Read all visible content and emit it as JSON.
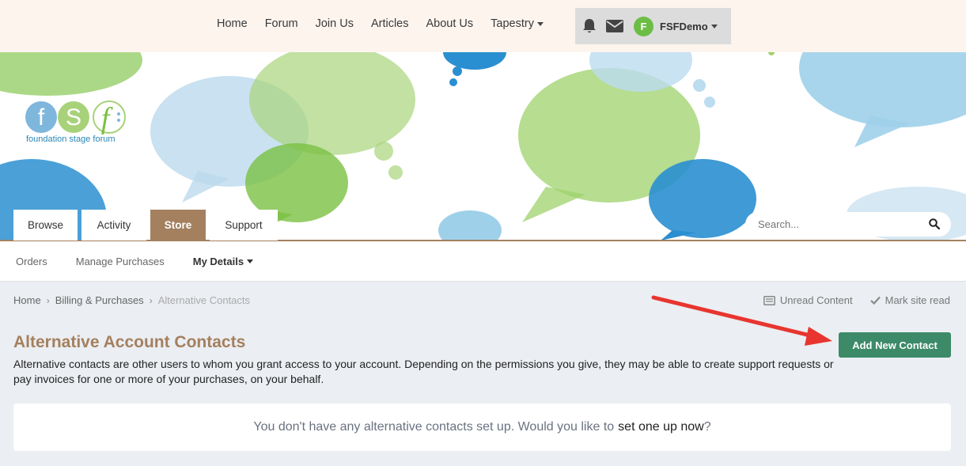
{
  "topnav": {
    "items": [
      "Home",
      "Forum",
      "Join Us",
      "Articles",
      "About Us",
      "Tapestry"
    ],
    "icons": [
      "bell-icon",
      "envelope-icon"
    ],
    "user": {
      "initial": "F",
      "name": "FSFDemo"
    }
  },
  "brand": {
    "letters": [
      "f",
      "S",
      "f"
    ],
    "tagline": "foundation stage forum"
  },
  "tabs": [
    "Browse",
    "Activity",
    "Store",
    "Support"
  ],
  "search": {
    "placeholder": "Search..."
  },
  "subnav": [
    "Orders",
    "Manage Purchases",
    "My Details"
  ],
  "breadcrumb": {
    "items": [
      "Home",
      "Billing & Purchases",
      "Alternative Contacts"
    ],
    "unread": "Unread Content",
    "mark_read": "Mark site read"
  },
  "page": {
    "title": "Alternative Account Contacts",
    "description": "Alternative contacts are other users to whom you grant access to your account. Depending on the permissions you give, they may be able to create support requests or pay invoices for one or more of your purchases, on your behalf.",
    "add_button": "Add New Contact",
    "empty_text": "You don't have any alternative contacts set up. Would you like to",
    "empty_link": "set one up now",
    "empty_suffix": "?"
  },
  "colors": {
    "accent": "#a4805f",
    "button": "#3d8a68",
    "avatar": "#6cbd45",
    "annotation_arrow": "#e8352f"
  }
}
